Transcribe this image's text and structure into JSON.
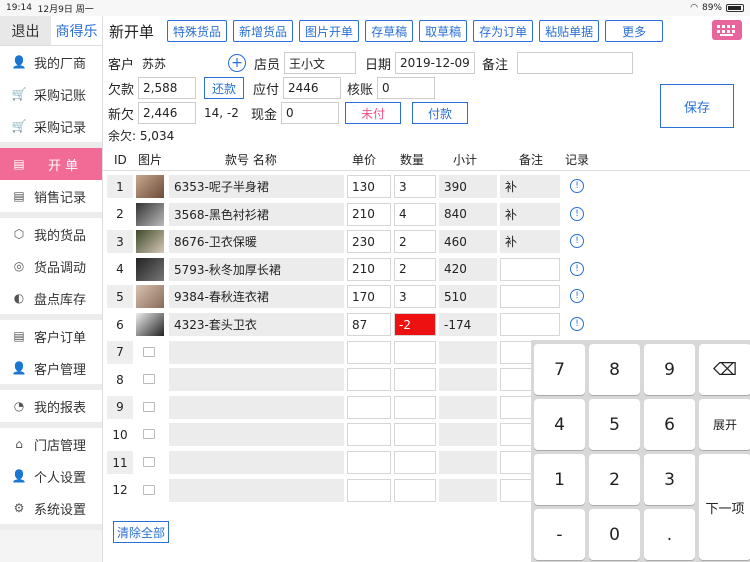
{
  "status": {
    "time": "19:14",
    "date": "12月9日 周一",
    "battery": "89%"
  },
  "sidebar": {
    "exit": "退出",
    "brand": "商得乐",
    "groups": [
      [
        {
          "name": "factory",
          "label": "我的厂商",
          "icon": "👤"
        },
        {
          "name": "purchase-ledger",
          "label": "采购记账",
          "icon": "🛒"
        },
        {
          "name": "purchase-record",
          "label": "采购记录",
          "icon": "🛒"
        }
      ],
      [
        {
          "name": "billing",
          "label": "开 单",
          "icon": "▤",
          "active": true
        },
        {
          "name": "sales-record",
          "label": "销售记录",
          "icon": "▤"
        }
      ],
      [
        {
          "name": "my-goods",
          "label": "我的货品",
          "icon": "⬡"
        },
        {
          "name": "goods-transfer",
          "label": "货品调动",
          "icon": "◎"
        },
        {
          "name": "stock-check",
          "label": "盘点库存",
          "icon": "◐"
        }
      ],
      [
        {
          "name": "customer-order",
          "label": "客户订单",
          "icon": "▤"
        },
        {
          "name": "customer-manage",
          "label": "客户管理",
          "icon": "👤"
        }
      ],
      [
        {
          "name": "my-report",
          "label": "我的报表",
          "icon": "◔"
        }
      ],
      [
        {
          "name": "store-manage",
          "label": "门店管理",
          "icon": "⌂"
        },
        {
          "name": "personal-settings",
          "label": "个人设置",
          "icon": "👤"
        },
        {
          "name": "system-settings",
          "label": "系统设置",
          "icon": "⚙"
        }
      ]
    ]
  },
  "toolbar": {
    "title": "新开单",
    "buttons": [
      "特殊货品",
      "新增货品",
      "图片开单",
      "存草稿",
      "取草稿",
      "存为订单",
      "粘贴单据",
      "更多"
    ]
  },
  "form": {
    "customer_label": "客户",
    "customer": "苏苏",
    "clerk_label": "店员",
    "clerk": "王小文",
    "date_label": "日期",
    "date": "2019-12-09",
    "note_label": "备注",
    "note": "",
    "debt_label": "欠款",
    "debt": "2,588",
    "repay": "还款",
    "payable_label": "应付",
    "payable": "2446",
    "verify_label": "核账",
    "verify": "0",
    "newdebt_label": "新欠",
    "newdebt": "2,446",
    "newdebt_extra": "14, -2",
    "cash_label": "现金",
    "cash": "0",
    "unpaid": "未付",
    "pay": "付款",
    "balance": "余欠: 5,034",
    "save": "保存"
  },
  "table": {
    "headers": {
      "id": "ID",
      "img": "图片",
      "code": "款号 名称",
      "price": "单价",
      "qty": "数量",
      "subtotal": "小计",
      "note": "备注",
      "record": "记录"
    },
    "rows": [
      {
        "id": "1",
        "code": "6353-呢子半身裙",
        "price": "130",
        "qty": "3",
        "subtotal": "390",
        "note": "补"
      },
      {
        "id": "2",
        "code": "3568-黑色衬衫裙",
        "price": "210",
        "qty": "4",
        "subtotal": "840",
        "note": "补"
      },
      {
        "id": "3",
        "code": "8676-卫衣保暖",
        "price": "230",
        "qty": "2",
        "subtotal": "460",
        "note": "补"
      },
      {
        "id": "4",
        "code": "5793-秋冬加厚长裙",
        "price": "210",
        "qty": "2",
        "subtotal": "420",
        "note": ""
      },
      {
        "id": "5",
        "code": "9384-春秋连衣裙",
        "price": "170",
        "qty": "3",
        "subtotal": "510",
        "note": ""
      },
      {
        "id": "6",
        "code": "4323-套头卫衣",
        "price": "87",
        "qty": "-2",
        "subtotal": "-174",
        "note": ""
      }
    ],
    "empty_ids": [
      "7",
      "8",
      "9",
      "10",
      "11",
      "12"
    ],
    "info_icon": "!"
  },
  "clear_all": "清除全部",
  "keypad": {
    "keys": [
      "7",
      "8",
      "9",
      "4",
      "5",
      "6",
      "1",
      "2",
      "3",
      "-",
      "0",
      "."
    ],
    "expand": "展开",
    "next": "下一项",
    "backspace": "⌫"
  },
  "colors": {
    "accent": "#2a6fd6",
    "active": "#f26b96",
    "alert": "#ee1111"
  }
}
